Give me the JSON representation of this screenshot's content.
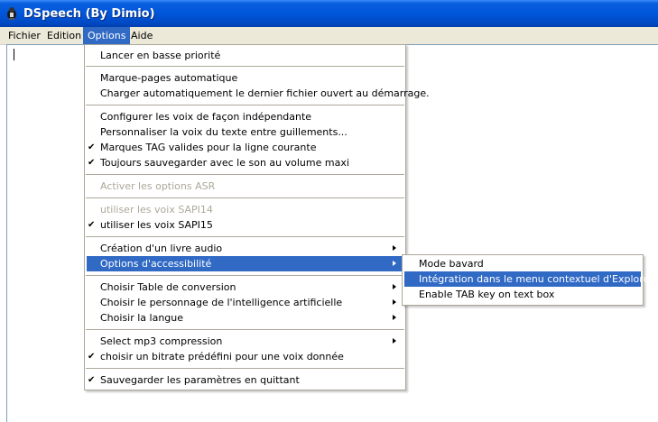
{
  "window": {
    "title": "DSpeech (By Dimio)"
  },
  "colors": {
    "titlebar": "#0054e3",
    "highlight": "#316ac5",
    "menubar": "#ece9d8",
    "disabled_text": "#aca899"
  },
  "menubar": [
    {
      "label": "Fichier",
      "active": false
    },
    {
      "label": "Edition",
      "active": false
    },
    {
      "label": "Options",
      "active": true
    },
    {
      "label": "Aide",
      "active": false
    }
  ],
  "options_menu": {
    "items": [
      {
        "label": "Lancer en basse priorité",
        "checked": false,
        "disabled": false,
        "submenu": false,
        "highlighted": false
      },
      {
        "label": "Marque-pages automatique",
        "checked": false,
        "disabled": false,
        "submenu": false,
        "highlighted": false
      },
      {
        "label": "Charger automatiquement le dernier fichier ouvert au démarrage.",
        "checked": false,
        "disabled": false,
        "submenu": false,
        "highlighted": false
      },
      {
        "label": "Configurer les voix de façon indépendante",
        "checked": false,
        "disabled": false,
        "submenu": false,
        "highlighted": false
      },
      {
        "label": "Personnaliser la voix du texte entre guillements...",
        "checked": false,
        "disabled": false,
        "submenu": false,
        "highlighted": false
      },
      {
        "label": "Marques TAG valides pour la ligne courante",
        "checked": true,
        "disabled": false,
        "submenu": false,
        "highlighted": false
      },
      {
        "label": "Toujours sauvegarder avec le son au volume maxi",
        "checked": true,
        "disabled": false,
        "submenu": false,
        "highlighted": false
      },
      {
        "label": "Activer les options ASR",
        "checked": false,
        "disabled": true,
        "submenu": false,
        "highlighted": false
      },
      {
        "label": "utiliser les voix SAPI14",
        "checked": false,
        "disabled": true,
        "submenu": false,
        "highlighted": false
      },
      {
        "label": "utiliser les voix SAPI15",
        "checked": true,
        "disabled": false,
        "submenu": false,
        "highlighted": false
      },
      {
        "label": "Création d'un livre audio",
        "checked": false,
        "disabled": false,
        "submenu": true,
        "highlighted": false
      },
      {
        "label": "Options d'accessibilité",
        "checked": false,
        "disabled": false,
        "submenu": true,
        "highlighted": true
      },
      {
        "label": "Choisir Table de conversion",
        "checked": false,
        "disabled": false,
        "submenu": true,
        "highlighted": false
      },
      {
        "label": "Choisir le personnage de l'intelligence artificielle",
        "checked": false,
        "disabled": false,
        "submenu": true,
        "highlighted": false
      },
      {
        "label": "Choisir la langue",
        "checked": false,
        "disabled": false,
        "submenu": true,
        "highlighted": false
      },
      {
        "label": "Select mp3 compression",
        "checked": false,
        "disabled": false,
        "submenu": true,
        "highlighted": false
      },
      {
        "label": "choisir un bitrate prédéfini pour une voix donnée",
        "checked": true,
        "disabled": false,
        "submenu": false,
        "highlighted": false
      },
      {
        "label": "Sauvegarder les paramètres en quittant",
        "checked": true,
        "disabled": false,
        "submenu": false,
        "highlighted": false
      }
    ]
  },
  "accessibility_submenu": {
    "items": [
      {
        "label": "Mode bavard",
        "highlighted": false
      },
      {
        "label": "Intégration dans le menu contextuel d'Explorer",
        "highlighted": true
      },
      {
        "label": "Enable TAB key on text box",
        "highlighted": false
      }
    ]
  },
  "icons": {
    "app": "dspeech-app-icon",
    "check": "checkmark-icon",
    "submenu": "submenu-arrow-icon"
  }
}
